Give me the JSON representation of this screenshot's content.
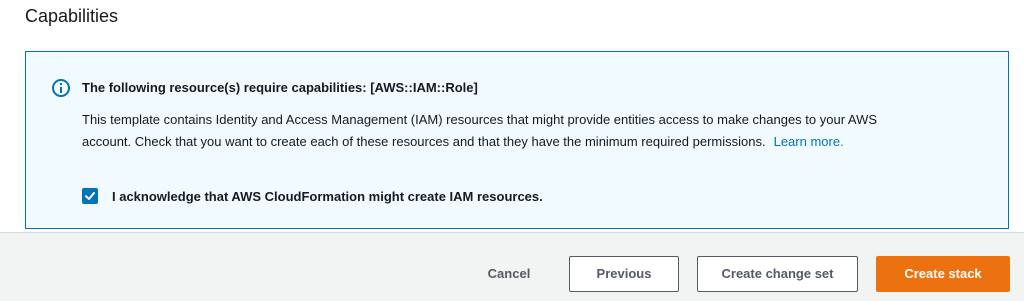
{
  "section": {
    "title": "Capabilities"
  },
  "alert": {
    "icon": "info-icon",
    "title": "The following resource(s) require capabilities: [AWS::IAM::Role]",
    "body_line1": "This template contains Identity and Access Management (IAM) resources that might provide entities access to make changes to your AWS",
    "body_line2": "account. Check that you want to create each of these resources and that they have the minimum required permissions.",
    "link_label": "Learn more.",
    "acknowledge": {
      "label": "I acknowledge that AWS CloudFormation might create IAM resources.",
      "checked": true
    }
  },
  "actions": {
    "cancel_label": "Cancel",
    "previous_label": "Previous",
    "create_change_set_label": "Create change set",
    "create_stack_label": "Create stack"
  },
  "colors": {
    "accent": "#0073bb",
    "primary_button": "#ec7211",
    "alert_background": "#f1faff",
    "page_background": "#f2f3f3"
  }
}
